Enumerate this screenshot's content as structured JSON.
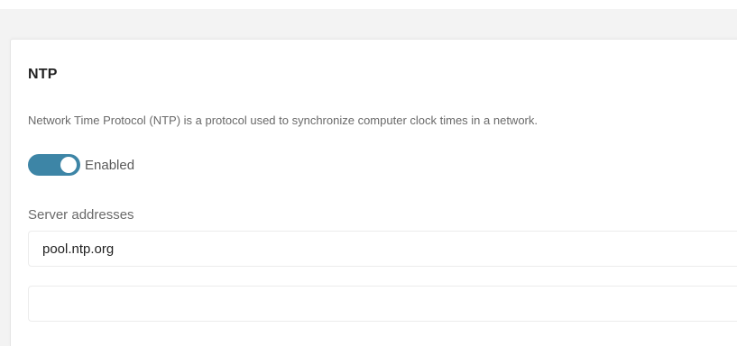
{
  "ntp": {
    "title": "NTP",
    "description": "Network Time Protocol (NTP) is a protocol used to synchronize computer clock times in a network.",
    "toggle": {
      "state": "on",
      "label": "Enabled"
    },
    "server_addresses": {
      "label": "Server addresses",
      "values": [
        "pool.ntp.org",
        ""
      ]
    }
  },
  "colors": {
    "accent": "#3d85a6",
    "background": "#f3f3f3",
    "card": "#ffffff"
  }
}
